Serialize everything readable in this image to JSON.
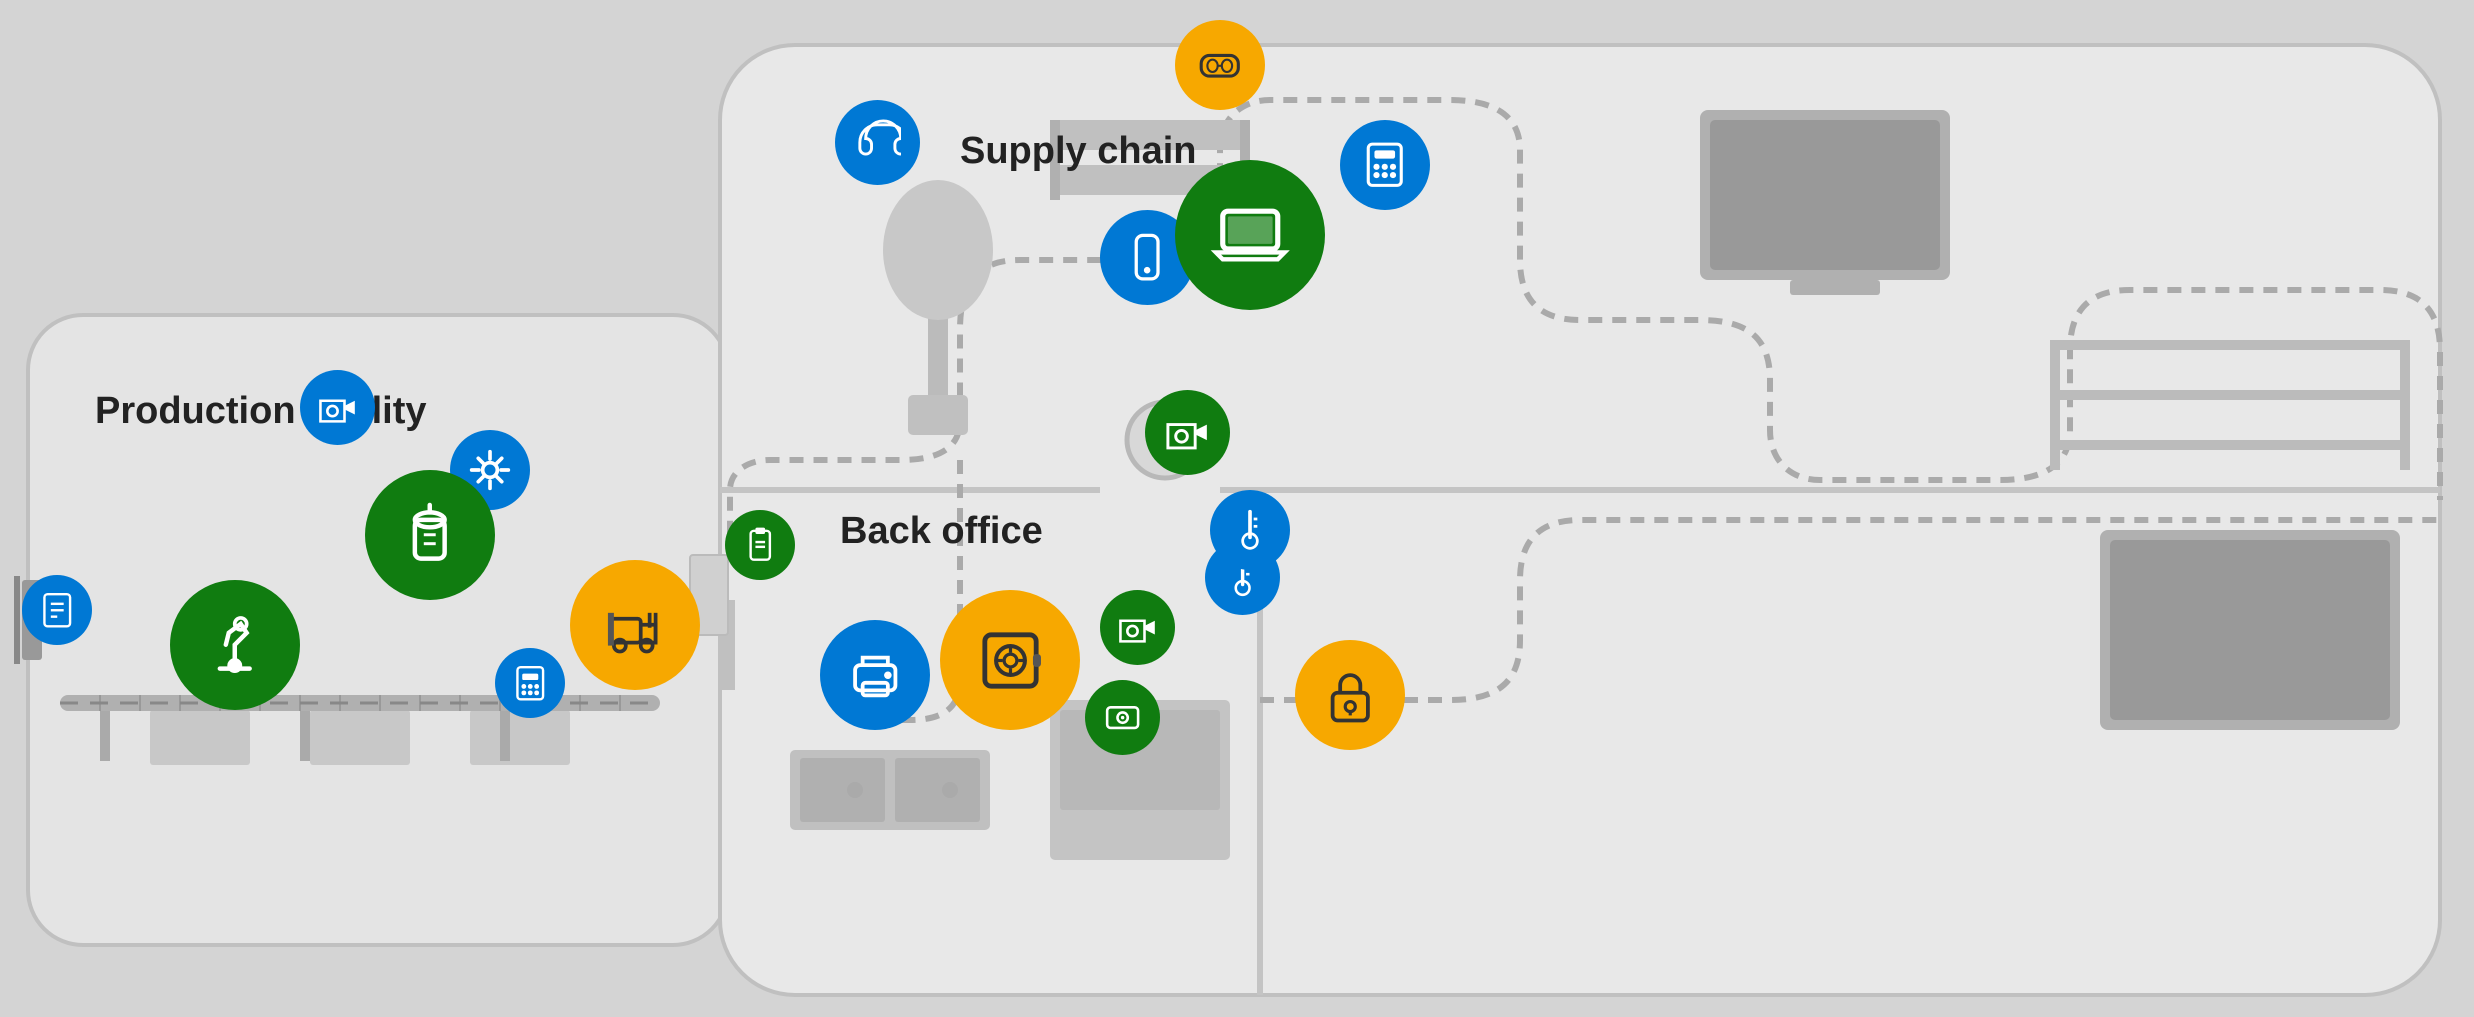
{
  "labels": {
    "production_facility": "Production facility",
    "back_office": "Back office",
    "supply_chain": "Supply chain"
  },
  "colors": {
    "blue": "#0078d4",
    "green": "#107c10",
    "yellow": "#f7a800",
    "background": "#d4d4d4",
    "building": "#e8e8e8",
    "wall": "#c8c8c8"
  },
  "icons": {
    "camera": "📷",
    "laptop": "💻",
    "phone": "📱",
    "printer": "🖨️",
    "safe": "🔐",
    "lock": "🔒",
    "robot_arm": "🦾",
    "tank": "⚗️",
    "forklift": "🚛",
    "calculator": "🧮",
    "keypad": "⌨️",
    "vr_headset": "🥽",
    "sensor": "📡",
    "badge": "🪪",
    "screen": "🖥️"
  }
}
